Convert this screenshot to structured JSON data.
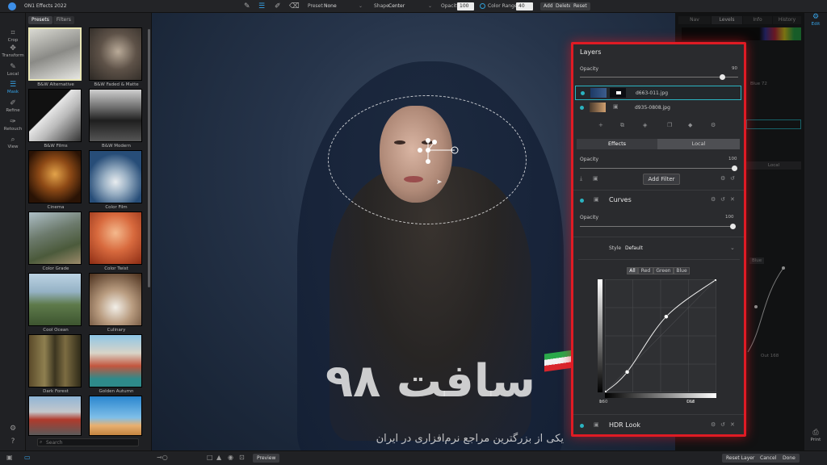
{
  "app": {
    "title": "ON1 Effects 2022"
  },
  "toolbar": {
    "preset_label": "Preset",
    "preset_value": "None",
    "shape_label": "Shape",
    "shape_value": "Center",
    "opacity_label": "Opacity",
    "opacity_value": "100",
    "color_range_label": "Color Range",
    "color_range_value": "40",
    "add_label": "Add",
    "delete_label": "Delete",
    "reset_label": "Reset"
  },
  "tools": [
    {
      "label": "Crop",
      "icon": "crop-icon"
    },
    {
      "label": "Transform",
      "icon": "transform-icon"
    },
    {
      "label": "Local",
      "icon": "brush-icon"
    },
    {
      "label": "Mask",
      "icon": "mask-icon"
    },
    {
      "label": "Refine",
      "icon": "refine-icon"
    },
    {
      "label": "Retouch",
      "icon": "retouch-icon"
    },
    {
      "label": "View",
      "icon": "zoom-icon"
    }
  ],
  "browser": {
    "tabs": [
      "Presets",
      "Filters"
    ],
    "presets": [
      "B&W Alternative",
      "B&W Faded & Matte",
      "B&W Films",
      "B&W Modern",
      "Cinema",
      "Color Film",
      "Color Grade",
      "Color Twist",
      "Cool Ocean",
      "Culinary",
      "Dark Forest",
      "Golden Autumn",
      "",
      ""
    ],
    "search_placeholder": "Search"
  },
  "right_panel": {
    "tabs": [
      "Nav",
      "Levels",
      "Info",
      "History"
    ],
    "visible_fragments": [
      "Blue 72",
      "Local",
      "Blue",
      "Out 168"
    ]
  },
  "mode_rail": {
    "edit_label": "Edit",
    "print_label": "Print"
  },
  "layers": {
    "title": "Layers",
    "opacity_label": "Opacity",
    "opacity_value": "90",
    "opacity_fraction": 0.9,
    "items": [
      {
        "name": "d663-011.jpg",
        "selected": true
      },
      {
        "name": "d935-0808.jpg",
        "selected": false
      }
    ],
    "tabs": [
      "Effects",
      "Local"
    ],
    "effects_opacity_label": "Opacity",
    "effects_opacity_value": "100",
    "add_filter_label": "Add Filter",
    "filters": [
      {
        "name": "Curves",
        "opacity_label": "Opacity",
        "opacity_value": "100",
        "style_label": "Style",
        "style_value": "Default"
      },
      {
        "name": "HDR Look"
      }
    ],
    "channels": [
      "All",
      "Red",
      "Green",
      "Blue"
    ],
    "curve_in_label": "In",
    "curve_in_value": "160",
    "curve_out_label": "Out",
    "curve_out_value": "168",
    "curve_points": [
      [
        0,
        0
      ],
      [
        0.2,
        0.18
      ],
      [
        0.55,
        0.67
      ],
      [
        1,
        1
      ]
    ]
  },
  "bottom": {
    "preview_label": "Preview",
    "reset_layer_label": "Reset Layer",
    "cancel_label": "Cancel",
    "done_label": "Done"
  },
  "watermark": {
    "text": "سافت ۹۸",
    "subtitle": "یکی از بزرگترین مراجع نرم‌افزاری در ایران"
  },
  "colors": {
    "accent": "#36a3e8",
    "teal": "#2bb3c0",
    "highlight_border": "#e01b24"
  }
}
